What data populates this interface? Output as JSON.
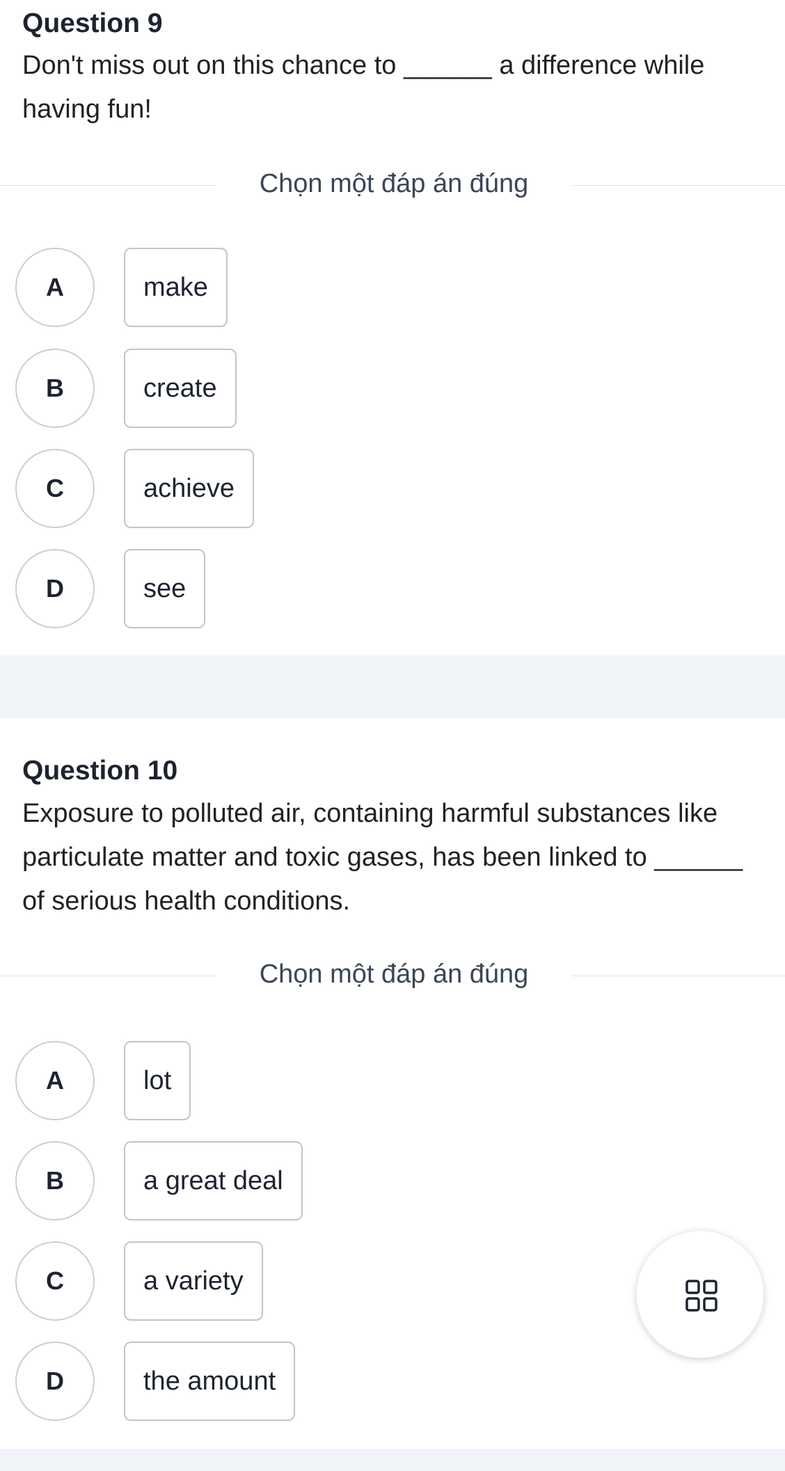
{
  "questions": [
    {
      "title": "Question 9",
      "text": "Don't miss out on this chance to ______ a difference while having fun!",
      "prompt": "Chọn một đáp án đúng",
      "options": [
        {
          "letter": "A",
          "text": "make"
        },
        {
          "letter": "B",
          "text": "create"
        },
        {
          "letter": "C",
          "text": "achieve"
        },
        {
          "letter": "D",
          "text": "see"
        }
      ]
    },
    {
      "title": "Question 10",
      "text": "Exposure to polluted air, containing harmful substances like particulate matter and toxic gases, has been linked to ______ of serious health conditions.",
      "prompt": "Chọn một đáp án đúng",
      "options": [
        {
          "letter": "A",
          "text": "lot"
        },
        {
          "letter": "B",
          "text": "a great deal"
        },
        {
          "letter": "C",
          "text": "a variety"
        },
        {
          "letter": "D",
          "text": "the amount"
        }
      ]
    }
  ],
  "fab": {
    "icon": "grid-menu-icon"
  },
  "colors": {
    "border": "#c9ced6",
    "band": "#f1f4f8",
    "text": "#1e2330"
  }
}
